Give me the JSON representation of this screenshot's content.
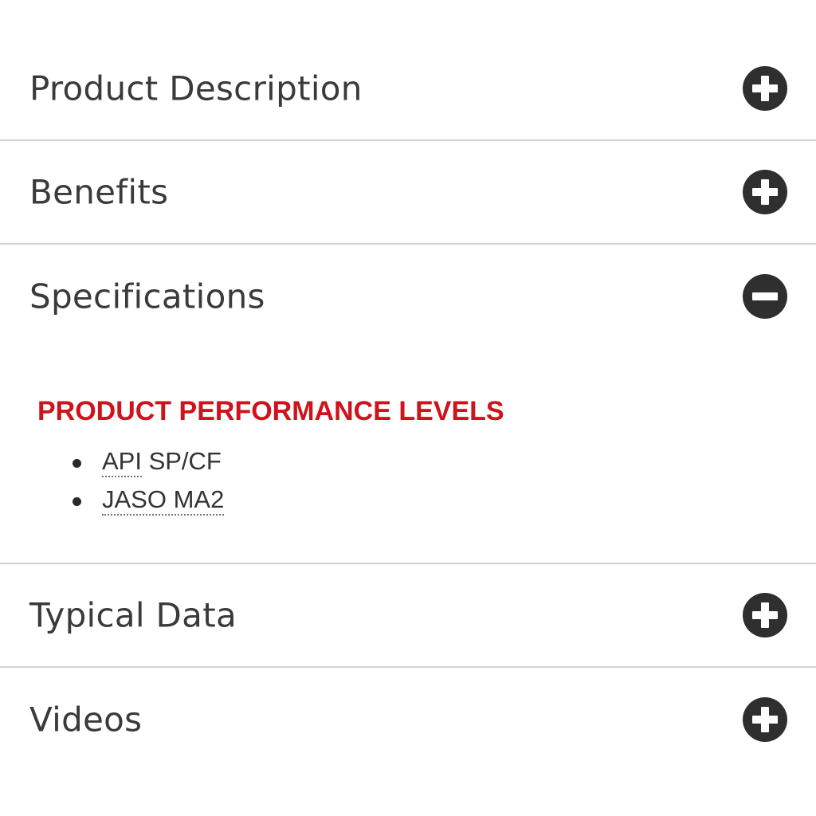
{
  "sections": [
    {
      "title": "Product Description",
      "icon": "plus-circle-icon",
      "expanded": false
    },
    {
      "title": "Benefits",
      "icon": "plus-circle-icon",
      "expanded": false
    },
    {
      "title": "Specifications",
      "icon": "minus-circle-icon",
      "expanded": true
    },
    {
      "title": "Typical Data",
      "icon": "plus-circle-icon",
      "expanded": false
    },
    {
      "title": "Videos",
      "icon": "plus-circle-icon",
      "expanded": false
    }
  ],
  "specifications": {
    "heading": "PRODUCT PERFORMANCE LEVELS",
    "items": [
      {
        "abbr": "API",
        "rest": " SP/CF"
      },
      {
        "abbr": "JASO MA2",
        "rest": ""
      }
    ]
  },
  "colors": {
    "heading_red": "#d0121b",
    "icon_dark": "#2f2f2f",
    "divider": "#d2d2d2",
    "text": "#3a3a3a"
  }
}
